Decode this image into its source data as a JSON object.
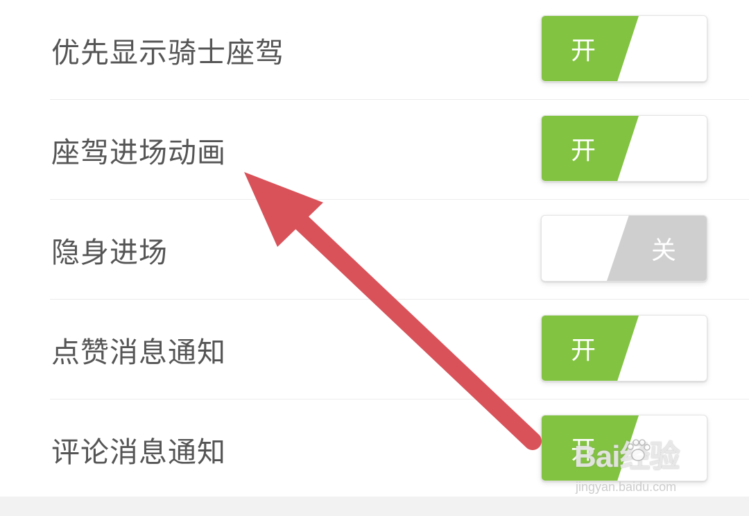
{
  "settings": [
    {
      "label": "优先显示骑士座驾",
      "state": "on",
      "toggle_text": "开"
    },
    {
      "label": "座驾进场动画",
      "state": "on",
      "toggle_text": "开"
    },
    {
      "label": "隐身进场",
      "state": "off",
      "toggle_text": "关"
    },
    {
      "label": "点赞消息通知",
      "state": "on",
      "toggle_text": "开"
    },
    {
      "label": "评论消息通知",
      "state": "on",
      "toggle_text": "开"
    }
  ],
  "colors": {
    "toggle_on": "#82c341",
    "toggle_off": "#cfcfcf",
    "annotation_arrow": "#d9525a",
    "label_text": "#555555"
  },
  "annotation": {
    "type": "arrow",
    "points_to": "座驾进场动画"
  },
  "watermark": {
    "main": "Bai经验",
    "sub": "jingyan.baidu.com"
  }
}
